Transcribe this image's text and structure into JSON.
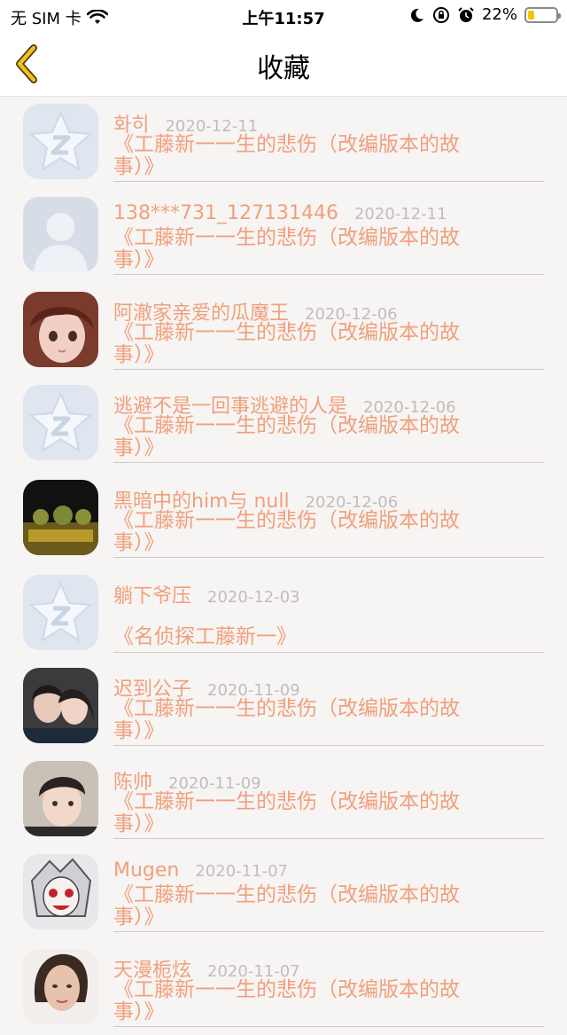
{
  "status_bar": {
    "carrier": "无 SIM 卡",
    "time": "上午11:57",
    "battery": "22%",
    "battery_level": 0.22
  },
  "nav": {
    "title": "收藏",
    "back_icon": "chevron-left-icon"
  },
  "colors": {
    "accent": "#f0a07a",
    "date": "#c2bcbc",
    "back": "#e9b800",
    "background": "#f7f4f4"
  },
  "items": [
    {
      "name": "화히",
      "date": "2020-12-11",
      "title": "《工藤新一一生的悲伤（改编版本的故事）》",
      "avatar": "qq-default-avatar"
    },
    {
      "name": "138***731_127131446",
      "date": "2020-12-11",
      "title": "《工藤新一一生的悲伤（改编版本的故事）》",
      "avatar": "person-silhouette-avatar"
    },
    {
      "name": "阿澈家亲爱的瓜魔王",
      "date": "2020-12-06",
      "title": "《工藤新一一生的悲伤（改编版本的故事）》",
      "avatar": "anime-girl-avatar"
    },
    {
      "name": "逃避不是一回事逃避的人是",
      "date": "2020-12-06",
      "title": "《工藤新一一生的悲伤（改编版本的故事）》",
      "avatar": "qq-default-avatar"
    },
    {
      "name": "黑暗中的him与 null",
      "date": "2020-12-06",
      "title": "《工藤新一一生的悲伤（改编版本的故事）》",
      "avatar": "game-scene-avatar"
    },
    {
      "name": "躺下爷压",
      "date": "2020-12-03",
      "title": "《名侦探工藤新一》",
      "avatar": "qq-default-avatar"
    },
    {
      "name": "迟到公子",
      "date": "2020-11-09",
      "title": "《工藤新一一生的悲伤（改编版本的故事）》",
      "avatar": "couple-photo-avatar"
    },
    {
      "name": "陈帅",
      "date": "2020-11-09",
      "title": "《工藤新一一生的悲伤（改编版本的故事）》",
      "avatar": "boy-photo-avatar"
    },
    {
      "name": "Mugen",
      "date": "2020-11-07",
      "title": "《工藤新一一生的悲伤（改编版本的故事）》",
      "avatar": "anime-character-avatar"
    },
    {
      "name": "天漫栀炫",
      "date": "2020-11-07",
      "title": "《工藤新一一生的悲伤（改编版本的故事）》",
      "avatar": "woman-photo-avatar"
    }
  ]
}
